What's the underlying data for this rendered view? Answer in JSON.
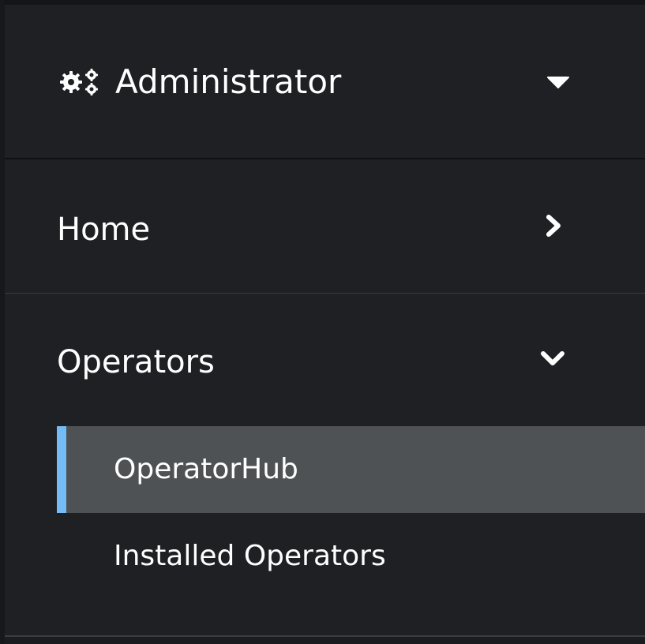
{
  "perspective": {
    "title": "Administrator",
    "icon": "gears-icon",
    "caret_icon": "caret-down-icon"
  },
  "nav": {
    "sections": [
      {
        "label": "Home",
        "expanded": false,
        "icon": "chevron-right-icon"
      },
      {
        "label": "Operators",
        "expanded": true,
        "icon": "chevron-down-icon"
      }
    ],
    "operators_items": [
      {
        "label": "OperatorHub",
        "active": true
      },
      {
        "label": "Installed Operators",
        "active": false
      }
    ]
  },
  "colors": {
    "background": "#1f2024",
    "active_item_bg": "#4f5255",
    "active_indicator": "#73bcf7",
    "text": "#ffffff",
    "divider": "#3a3c42"
  }
}
